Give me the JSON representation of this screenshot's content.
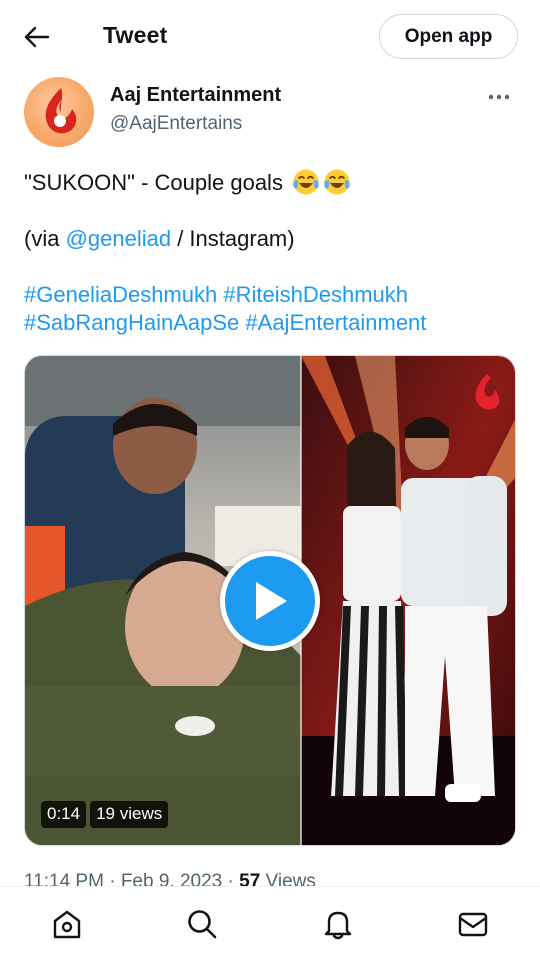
{
  "header": {
    "title": "Tweet",
    "open_app_label": "Open app"
  },
  "author": {
    "name": "Aaj Entertainment",
    "handle": "@AajEntertains"
  },
  "tweet": {
    "line1_text": "\"SUKOON\" - Couple goals",
    "line1_emojis": [
      "face-with-tears-of-joy",
      "face-with-tears-of-joy"
    ],
    "via_prefix": "(via ",
    "via_mention": "@geneliad",
    "via_suffix": " / Instagram)",
    "hashtags": [
      "#GeneliaDeshmukh",
      "#RiteishDeshmukh",
      "#SabRangHainAapSe",
      "#AajEntertainment"
    ]
  },
  "media": {
    "duration": "0:14",
    "views_label": "19 views"
  },
  "meta": {
    "time": "11:14 PM",
    "separator": "·",
    "date": "Feb 9, 2023",
    "views_count": "57",
    "views_word": "Views"
  },
  "colors": {
    "accent": "#1d9bf0",
    "text": "#0f1419",
    "secondary": "#536471"
  },
  "tabbar": {
    "items": [
      "home-icon",
      "search-icon",
      "notifications-icon",
      "messages-icon"
    ]
  }
}
